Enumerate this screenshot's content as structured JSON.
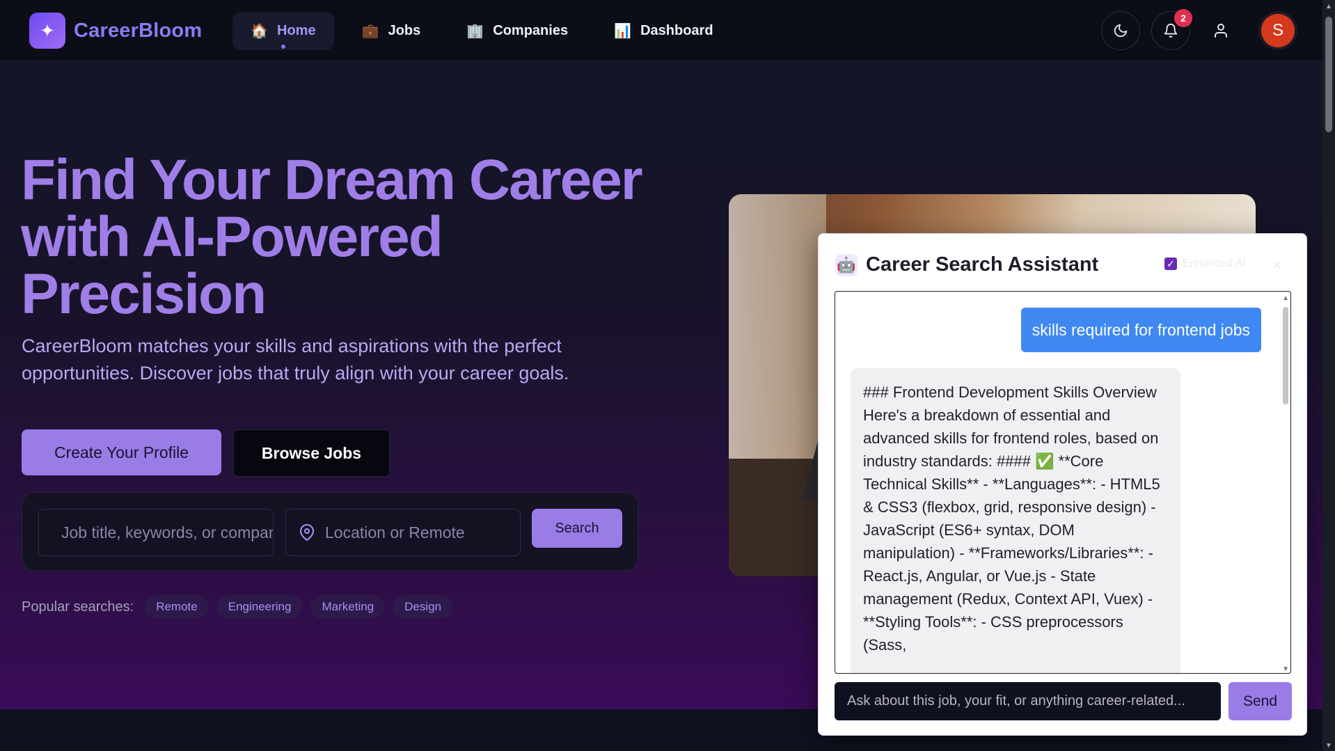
{
  "brand": {
    "name": "CareerBloom",
    "logo_icon": "sparkles-icon"
  },
  "nav": {
    "items": [
      {
        "label": "Home",
        "icon": "house-icon",
        "glyph": "🏠",
        "active": true
      },
      {
        "label": "Jobs",
        "icon": "briefcase-icon",
        "glyph": "💼",
        "active": false
      },
      {
        "label": "Companies",
        "icon": "building-icon",
        "glyph": "🏢",
        "active": false
      },
      {
        "label": "Dashboard",
        "icon": "bar-chart-icon",
        "glyph": "📊",
        "active": false
      }
    ],
    "notifications_count": "2",
    "avatar_initial": "S"
  },
  "hero": {
    "headline": "Find Your Dream Career with AI-Powered Precision",
    "subtext": "CareerBloom matches your skills and aspirations with the perfect opportunities. Discover jobs that truly align with your career goals.",
    "primary_cta": "Create Your Profile",
    "secondary_cta": "Browse Jobs",
    "search": {
      "keyword_placeholder": "Job title, keywords, or company",
      "location_placeholder": "Location or Remote",
      "button": "Search"
    },
    "popular_label": "Popular searches:",
    "popular_tags": [
      "Remote",
      "Engineering",
      "Marketing",
      "Design"
    ]
  },
  "chat": {
    "title": "Career Search Assistant",
    "enhanced_label": "Enhanced AI",
    "enhanced_checked": true,
    "close_label": "×",
    "user_message": "skills required for frontend jobs",
    "bot_message": "### Frontend Development Skills Overview Here's a breakdown of essential and advanced skills for frontend roles, based on industry standards: #### ✅ **Core Technical Skills** - **Languages**: - HTML5 & CSS3 (flexbox, grid, responsive design) - JavaScript (ES6+ syntax, DOM manipulation) - **Frameworks/Libraries**: - React.js, Angular, or Vue.js - State management (Redux, Context API, Vuex) - **Styling Tools**: - CSS preprocessors (Sass,",
    "input_placeholder": "Ask about this job, your fit, or anything career-related...",
    "send_label": "Send"
  },
  "colors": {
    "accent": "#9a7ce6",
    "headline": "#a07ee8",
    "user_bubble": "#3f88f2",
    "badge": "#e03050",
    "avatar": "#d3391d"
  }
}
